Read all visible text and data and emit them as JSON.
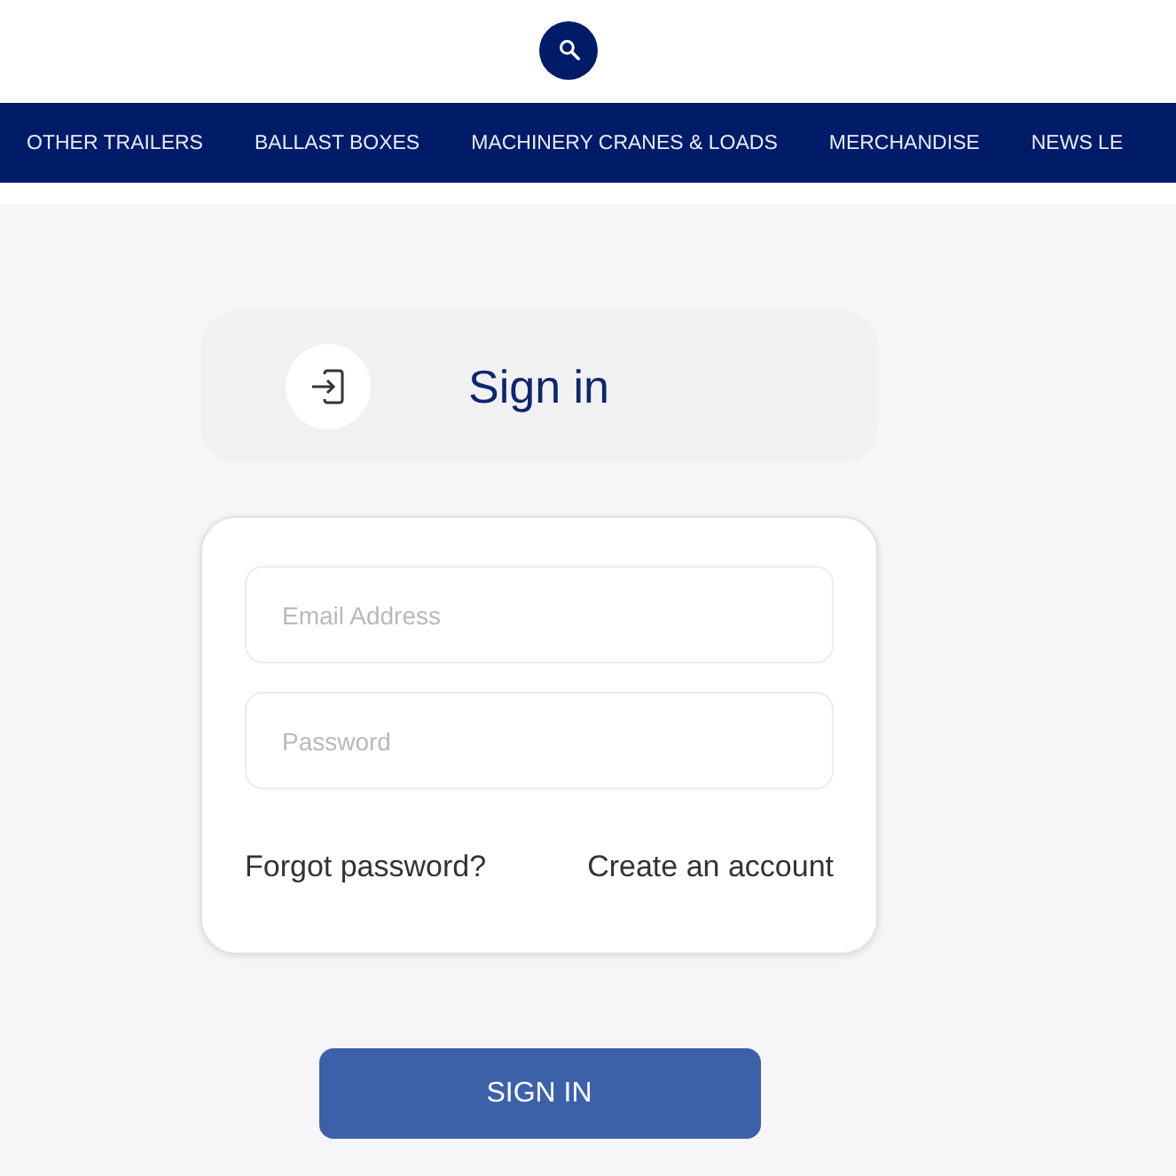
{
  "nav": {
    "items": [
      "OTHER TRAILERS",
      "BALLAST BOXES",
      "MACHINERY CRANES & LOADS",
      "MERCHANDISE",
      "NEWS LE"
    ]
  },
  "sign_in_panel": {
    "title": "Sign in"
  },
  "form": {
    "fields": [
      {
        "placeholder": "Email Address"
      },
      {
        "placeholder": "Password"
      }
    ],
    "links": [
      "Forgot password?",
      "Create an account"
    ]
  },
  "submit_button": {
    "label": "SIGN IN"
  }
}
